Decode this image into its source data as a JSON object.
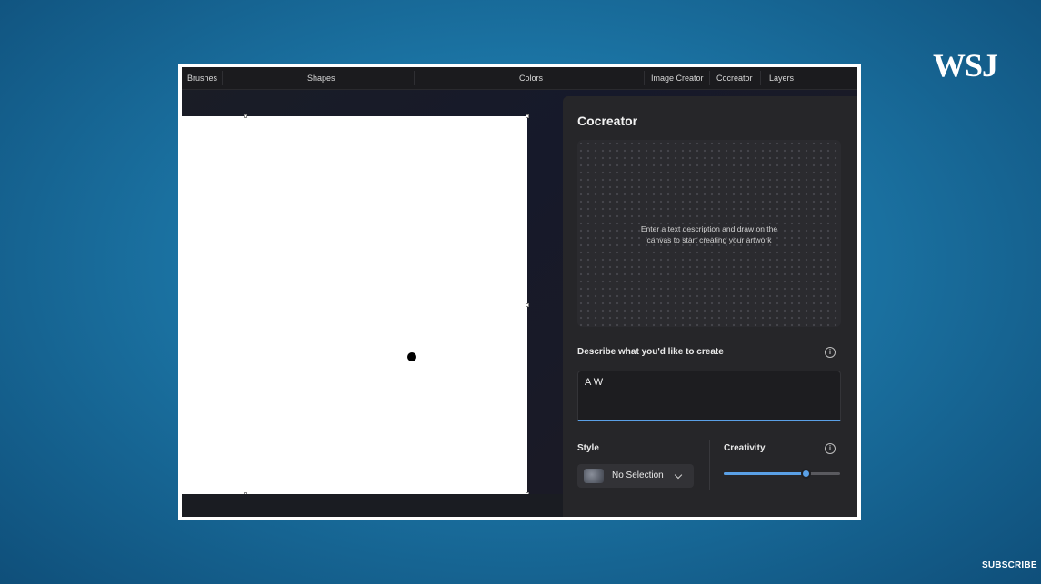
{
  "overlay": {
    "logo": "WSJ",
    "subscribe": "SUBSCRIBE"
  },
  "toolbar": {
    "brushes": "Brushes",
    "shapes": "Shapes",
    "colors": "Colors",
    "image_creator": "Image Creator",
    "cocreator": "Cocreator",
    "layers": "Layers"
  },
  "panel": {
    "title": "Cocreator",
    "preview_text": "Enter a text description and draw on the canvas to start creating your artwork",
    "describe_label": "Describe what you'd like to create",
    "prompt_value": "A W",
    "style_label": "Style",
    "style_value": "No Selection",
    "creativity_label": "Creativity",
    "creativity_level": 0.7
  },
  "colors": {
    "accent": "#5aa0e6",
    "panel_bg": "#262629",
    "canvas_bg": "#ffffff"
  }
}
